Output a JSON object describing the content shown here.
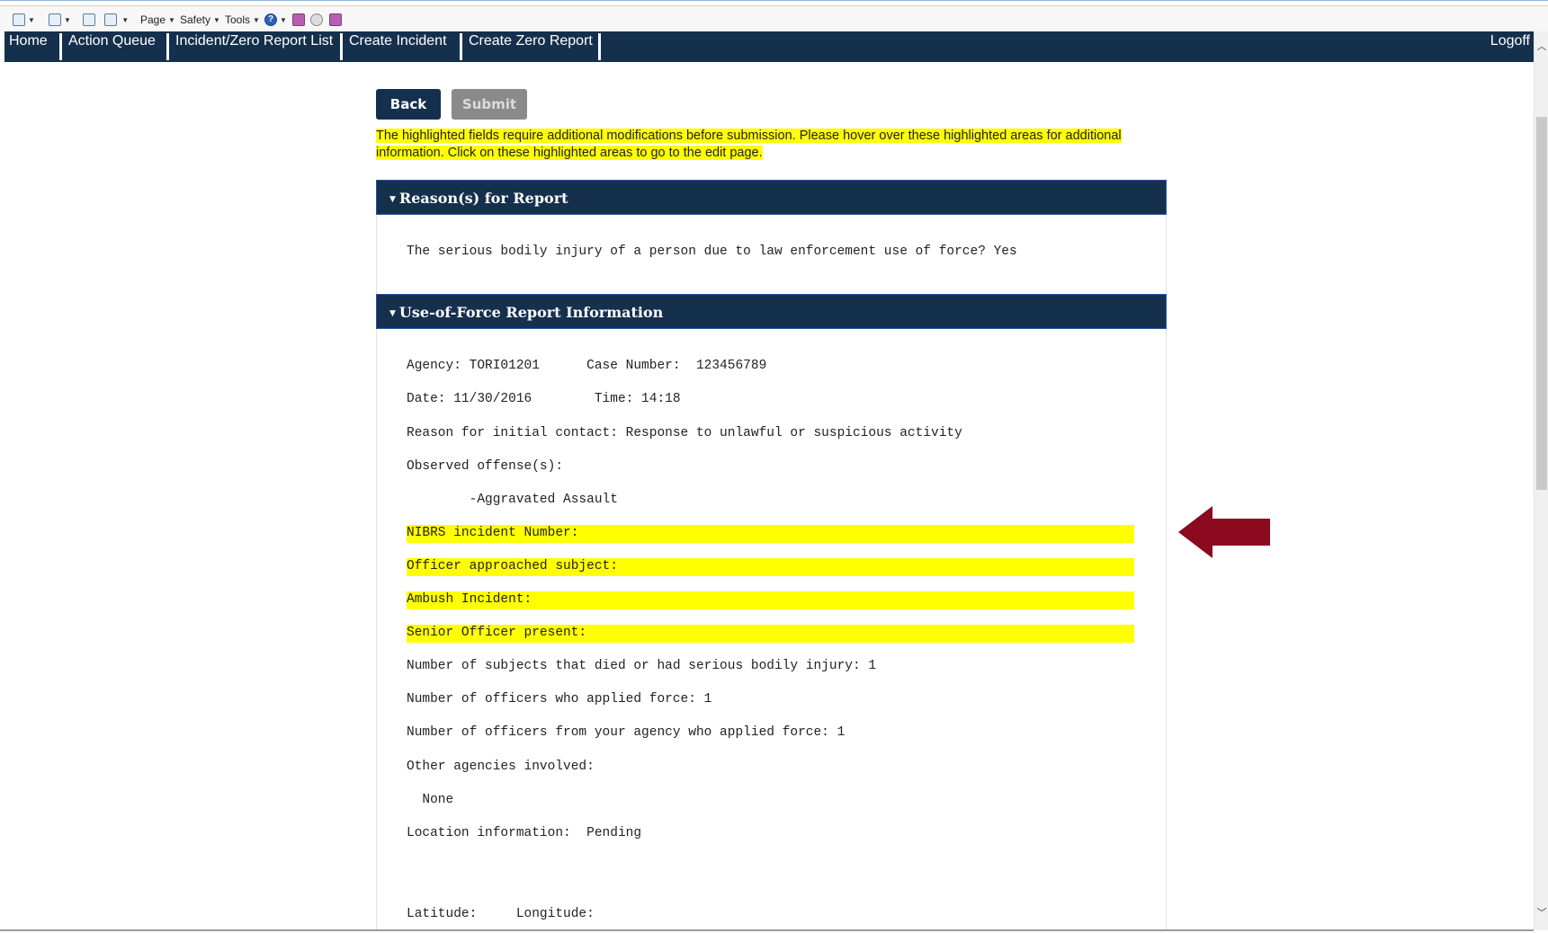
{
  "browser_toolbar": {
    "items": [
      {
        "name": "home-icon"
      },
      {
        "name": "feeds-icon"
      },
      {
        "name": "mail-icon"
      },
      {
        "name": "print-icon"
      },
      {
        "label": "Page"
      },
      {
        "label": "Safety"
      },
      {
        "label": "Tools"
      },
      {
        "name": "help-icon",
        "glyph": "?"
      },
      {
        "name": "addon-icon-1"
      },
      {
        "name": "addon-gear-icon"
      },
      {
        "name": "addon-icon-2"
      }
    ],
    "page_label": "Page",
    "safety_label": "Safety",
    "tools_label": "Tools"
  },
  "nav": {
    "items": [
      "Home",
      "Action Queue",
      "Incident/Zero Report List",
      "Create Incident",
      "Create Zero Report"
    ],
    "logoff": "Logoff"
  },
  "actions": {
    "back": "Back",
    "submit": "Submit"
  },
  "warning_text": "The highlighted fields require additional modifications before submission.  Please hover over these highlighted areas for additional information. Click on these highlighted areas to go to the edit page.",
  "sections": {
    "reasons": {
      "title": "Reason(s) for Report",
      "line": "The serious bodily injury of a person due to law enforcement use of force? Yes"
    },
    "uof": {
      "title": "Use-of-Force Report Information",
      "agency_line": "Agency: TORI01201      Case Number:  123456789",
      "date_line": "Date: 11/30/2016        Time: 14:18",
      "reason_line": "Reason for initial contact: Response to unlawful or suspicious activity",
      "observed_label": "Observed offense(s):",
      "offense_item": "        -Aggravated Assault",
      "highlighted": [
        "NIBRS incident Number:",
        "Officer approached subject:",
        "Ambush Incident:",
        "Senior Officer present:"
      ],
      "subjects_line": "Number of subjects that died or had serious bodily injury: 1",
      "officers_line": "Number of officers who applied force: 1",
      "agency_officers_line": "Number of officers from your agency who applied force: 1",
      "other_agencies_label": "Other agencies involved:",
      "other_agencies_value": "  None",
      "location_line": "Location information:  Pending",
      "latlon_line": "Latitude:     Longitude:"
    }
  },
  "colors": {
    "nav_bg": "#15304d",
    "highlight": "#ffff00",
    "arrow": "#8b0a1e",
    "submit_disabled": "#8a8a8a"
  }
}
